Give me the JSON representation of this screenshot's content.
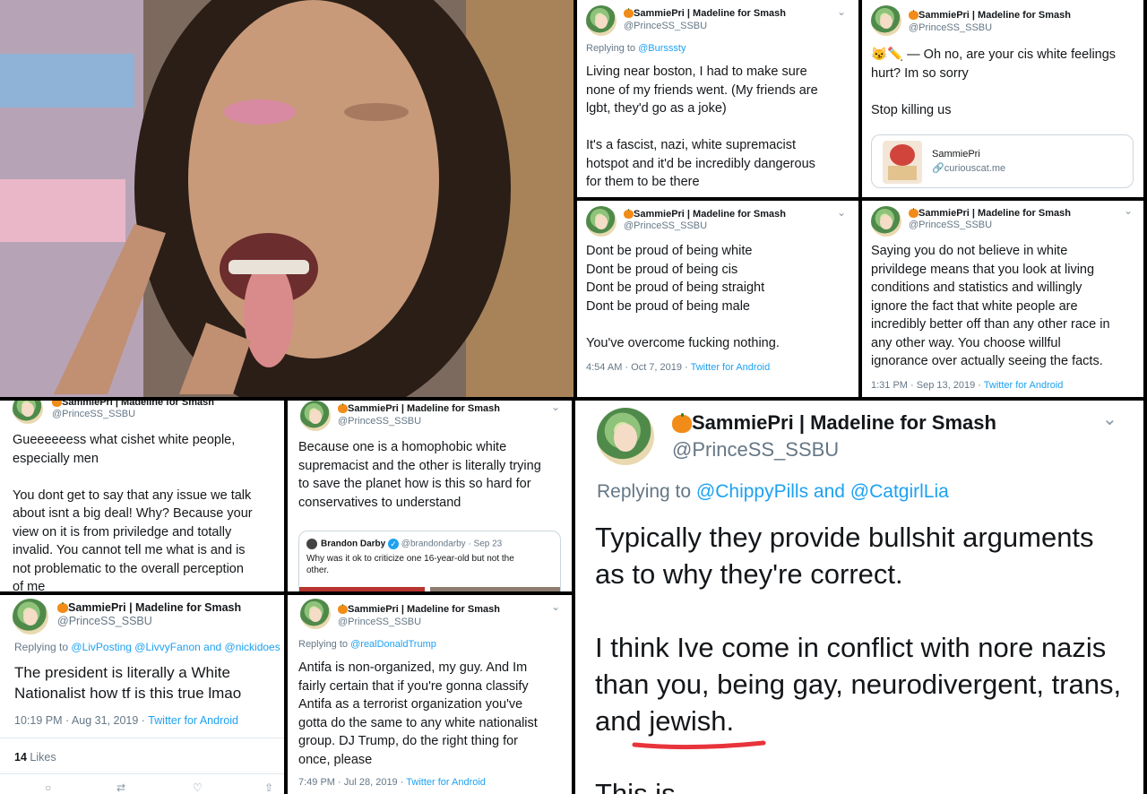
{
  "colors": {
    "link": "#1da1f2",
    "muted": "#657786",
    "underline": "#e8333b",
    "pumpkin": "#f28c18"
  },
  "common": {
    "name": "SammiePri | Madeline for Smash",
    "handle": "@PrinceSS_SSBU",
    "chevron": "⌄",
    "source": "Twitter for Android"
  },
  "tweet1": {
    "replying_prefix": "Replying to",
    "replying_user": "@Bursssty",
    "text": "Living near boston, I had to make sure\nnone of my friends went. (My friends are\nlgbt, they'd go as a joke)\n\nIt's a fascist, nazi, white supremacist\nhotspot and it'd be incredibly dangerous\nfor them to be there"
  },
  "tweet2": {
    "emoji": "😼✏️",
    "text": " — Oh no, are your cis white feelings\nhurt? Im so sorry\n\nStop killing us",
    "card_title": "SammiePri",
    "card_link": "curiouscat.me"
  },
  "tweet3": {
    "text": "Dont be proud of being white\nDont be proud of being cis\nDont be proud of being straight\nDont be proud of being male\n\nYou've overcome fucking nothing.",
    "time": "4:54 AM · Oct 7, 2019 · "
  },
  "tweet4": {
    "text": "Saying you do not believe in white\nprivildege means that you look at living\nconditions and statistics and willingly\nignore the fact that white people are\nincredibly better off than any other race in\nany other way. You choose willful\nignorance over actually seeing the facts.",
    "time": "1:31 PM · Sep 13, 2019 · "
  },
  "tweet5": {
    "text": "Gueeeeeess what cishet white people,\nespecially men\n\nYou dont get to say that any issue we talk\nabout isnt a big deal! Why? Because your\nview on it is from priviledge and totally\ninvalid. You cannot tell me what is and is\nnot problematic to the overall perception\nof me"
  },
  "tweet6": {
    "text": "Because one is a homophobic white\nsupremacist and the other is literally trying\nto save the planet how is this so hard for\nconservatives to understand",
    "quote_name": "Brandon Darby",
    "quote_handle": "@brandondarby · Sep 23",
    "quote_text": "Why was it ok to criticize one 16-year-old but not the\nother."
  },
  "tweet7": {
    "replying_prefix": "Replying to",
    "replying_users": "@LivPosting @LivvyFanon and @nickidoes",
    "text": "The president is literally a White\nNationalist how tf is this true lmao",
    "time": "10:19 PM · Aug 31, 2019 · ",
    "likes_count": "14",
    "likes_label": "Likes"
  },
  "tweet8": {
    "replying_prefix": "Replying to",
    "replying_user": "@realDonaldTrump",
    "text": "Antifa is non-organized, my guy. And Im\nfairly certain that if you're gonna classify\nAntifa as a terrorist organization you've\ngotta do the same to any white nationalist\ngroup. DJ Trump, do the right thing for\nonce, please",
    "time": "7:49 PM · Jul 28, 2019 · "
  },
  "tweet9": {
    "replying_prefix": "Replying to",
    "replying_users": "@ChippyPills and @CatgirlLia",
    "text": "Typically they provide bullshit arguments\nas to why they're correct.\n\nI think Ive come in conflict with nore nazis\nthan you, being gay, neurodivergent, trans,\nand jewish.",
    "cutoff": "This is ..."
  }
}
